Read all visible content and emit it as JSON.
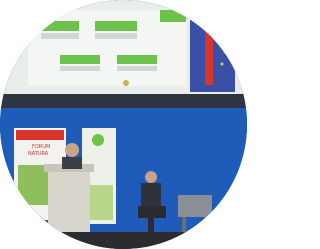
{
  "photo": {
    "colors": {
      "wall_blue": "#1f5bb8",
      "screen_white": "#eef2f0",
      "slide_green": "#6cc24a",
      "banner_red": "#d9342b",
      "stage_dark": "#2b2b30",
      "chair_gray": "#8a8f96"
    },
    "slide_boxes": [
      {
        "name": "slide-box-top-left",
        "label": ""
      },
      {
        "name": "slide-box-top-right",
        "label": ""
      },
      {
        "name": "slide-box-bottom-left",
        "label": ""
      },
      {
        "name": "slide-box-bottom-right",
        "label": ""
      }
    ],
    "banner_text": [
      "FORUM",
      "NATURA"
    ]
  }
}
